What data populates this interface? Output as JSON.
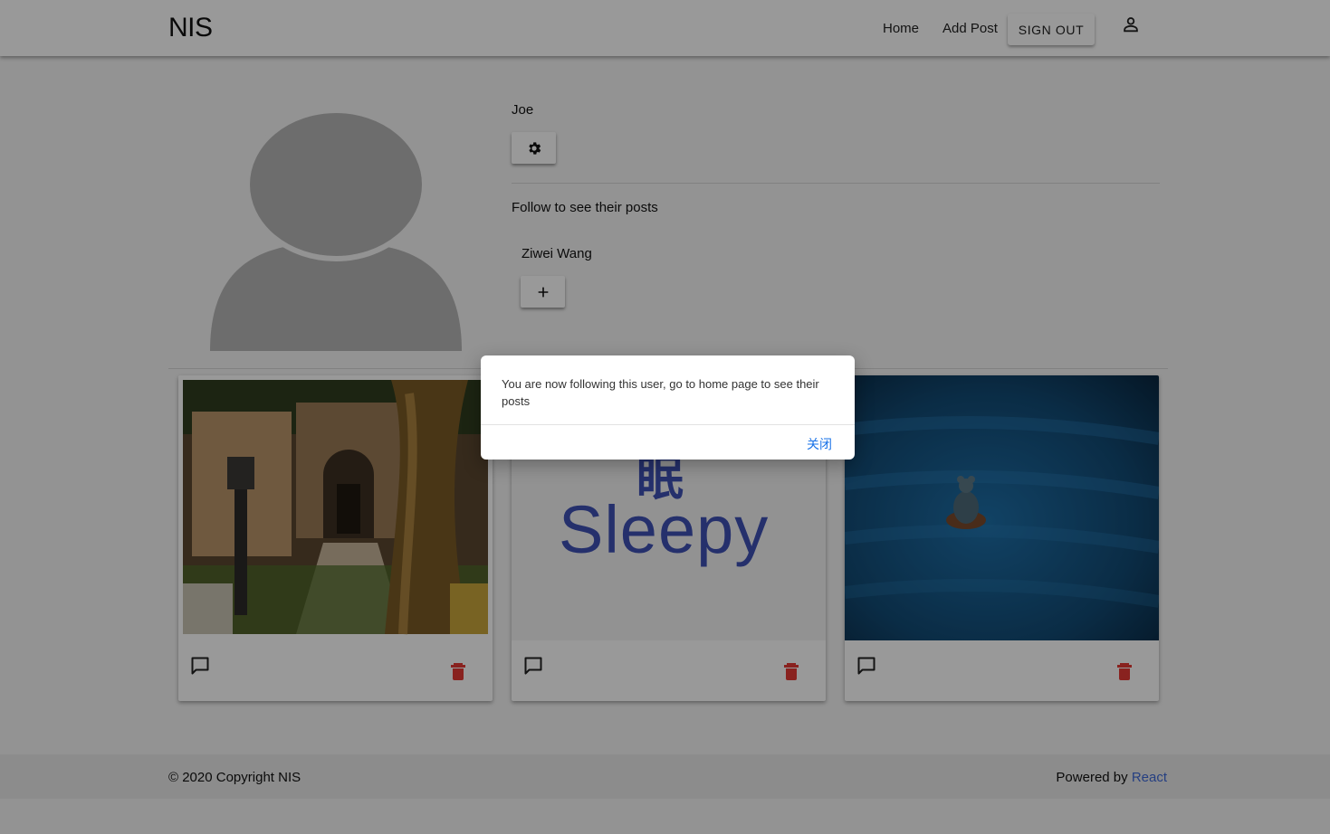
{
  "header": {
    "brand": "NIS",
    "nav": {
      "home": "Home",
      "add_post": "Add Post",
      "sign_out": "SIGN OUT"
    }
  },
  "profile": {
    "username": "Joe",
    "follow_title": "Follow to see their posts",
    "suggested_user": "Ziwei Wang"
  },
  "posts": [
    {
      "image": "fantasy-village-gate"
    },
    {
      "image": "sleepy-text",
      "text_cn": "眠",
      "text_en": "Sleepy"
    },
    {
      "image": "figurine-on-blue-fabric"
    }
  ],
  "dialog": {
    "message": "You are now following this user, go to home page to see their posts",
    "close_label": "关闭"
  },
  "footer": {
    "copyright": "© 2020 Copyright NIS",
    "powered_by": "Powered by ",
    "powered_link": "React"
  },
  "colors": {
    "accent_blue": "#3f51b5",
    "delete_red": "#e53935",
    "link_blue": "#3f6ad8",
    "dialog_button": "#1a73e8"
  },
  "icons": [
    "user-icon",
    "gear-icon",
    "plus-icon",
    "comment-icon",
    "trash-icon"
  ]
}
